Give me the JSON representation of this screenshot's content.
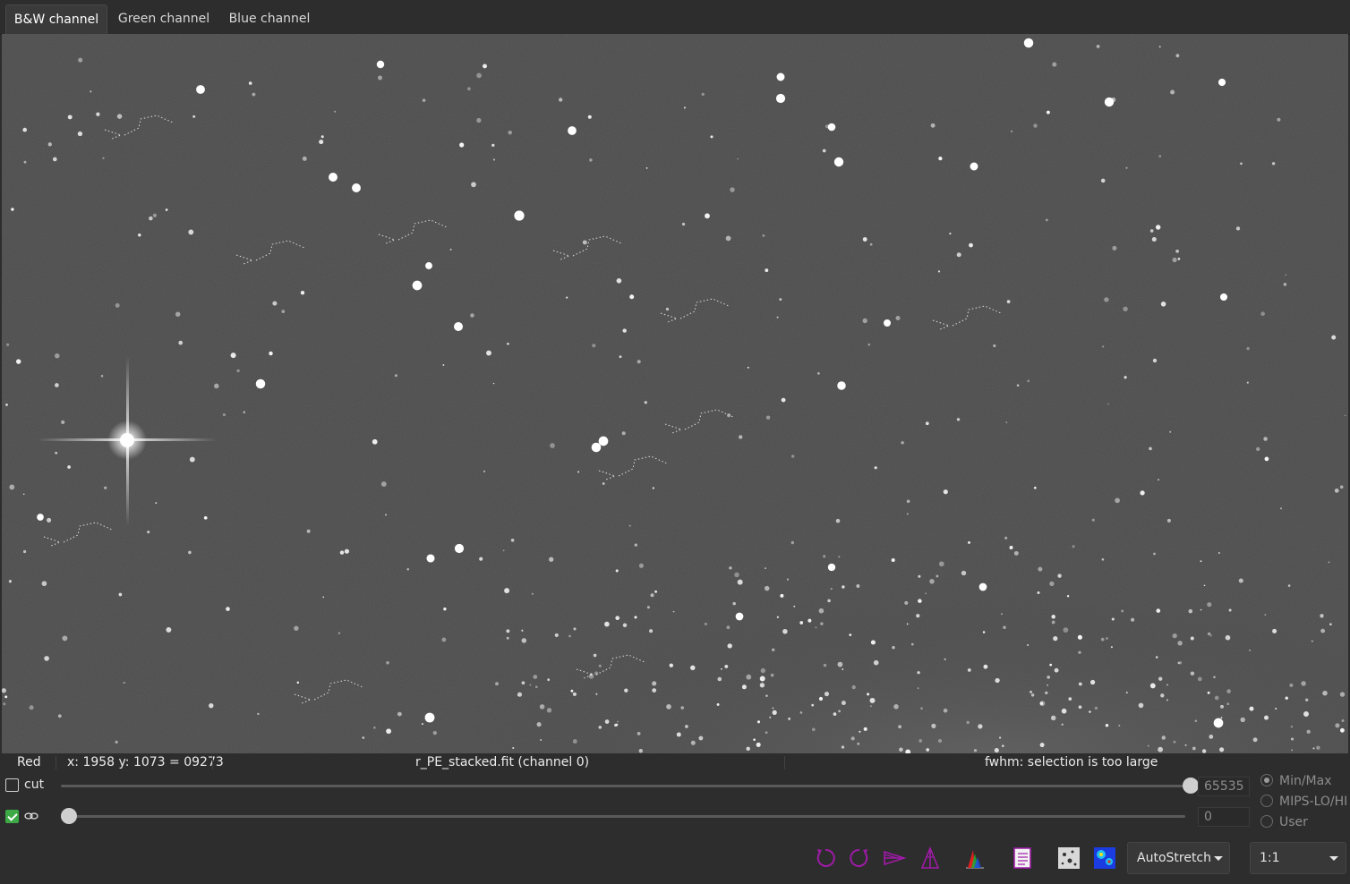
{
  "tabs": [
    {
      "label": "B&W channel",
      "active": true
    },
    {
      "label": "Green channel",
      "active": false
    },
    {
      "label": "Blue channel",
      "active": false
    }
  ],
  "status": {
    "channel": "Red",
    "coords": "x: 1958 y: 1073 = 09273",
    "filename": "r_PE_stacked.fit (channel 0)",
    "fwhm": "fwhm: selection is too large"
  },
  "sliders": {
    "cut": {
      "label": "cut",
      "checked": false,
      "value": "65535",
      "fraction": 1.0
    },
    "low": {
      "checked": true,
      "link_icon": "link-icon",
      "value": "0",
      "fraction": 0.0
    }
  },
  "scale_modes": {
    "options": [
      "Min/Max",
      "MIPS-LO/HI",
      "User"
    ],
    "selected": "Min/Max"
  },
  "toolbar": {
    "icons": [
      "rotate-left-icon",
      "rotate-right-icon",
      "flip-horizontal-icon",
      "flip-vertical-icon",
      "histogram-icon",
      "log-icon",
      "negative-view-icon",
      "false-color-icon"
    ],
    "stretch_mode": "AutoStretch",
    "zoom": "1:1"
  },
  "colors": {
    "background": "#2d2d2d",
    "sky": "#454545",
    "star": "#ffffff",
    "accent_check": "#3daa47",
    "tool_magenta": "#a01aa8"
  }
}
